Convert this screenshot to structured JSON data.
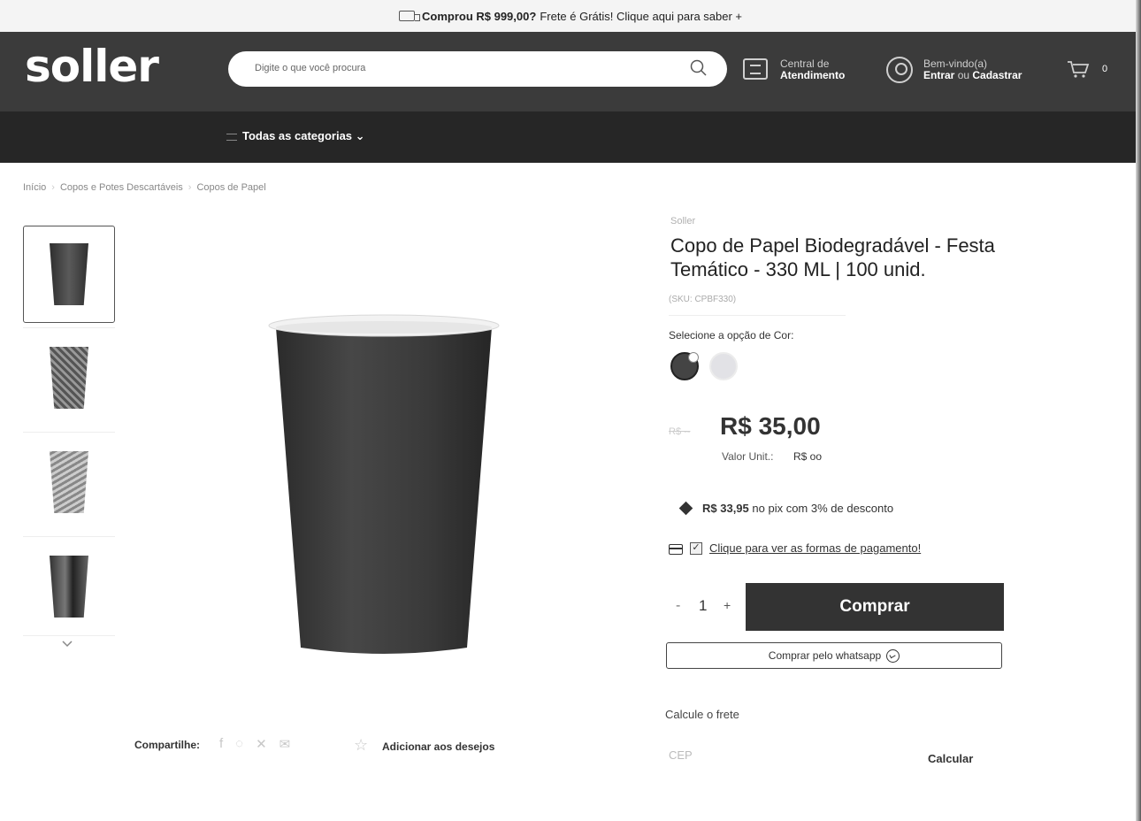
{
  "promo": {
    "bold": "Comprou R$ 999,00?",
    "text": "Frete é Grátis! Clique aqui para saber +"
  },
  "header": {
    "logo": "soller",
    "search_placeholder": "Digite o que você procura",
    "atendimento_line1": "Central de",
    "atendimento_line2": "Atendimento",
    "user_line1": "Bem-vindo(a)",
    "user_entrar": "Entrar",
    "user_ou": "ou",
    "user_cadastrar": "Cadastrar",
    "cart_count": "0"
  },
  "nav": {
    "all_categories": "Todas as categorias"
  },
  "breadcrumb": [
    "Início",
    "Copos e Potes Descartáveis",
    "Copos de Papel"
  ],
  "product": {
    "brand": "Soller",
    "title": "Copo de Papel Biodegradável - Festa Temático - 330 ML | 100 unid.",
    "sku": "(SKU: CPBF330)",
    "color_label": "Selecione a opção de Cor:",
    "price": "R$ 35,00",
    "unit_label": "Valor Unit.:",
    "unit_value": "R$ oo",
    "pix_amount": "R$ 33,95",
    "pix_text": "no pix com 3% de desconto",
    "payment_link": "Clique para ver as formas de pagamento!",
    "quantity": "1",
    "buy_label": "Comprar",
    "whatsapp_label": "Comprar pelo whatsapp",
    "frete_label": "Calcule o frete",
    "cep_placeholder": "CEP",
    "calc_label": "Calcular"
  },
  "share": {
    "label": "Compartilhe:",
    "wishlist": "Adicionar aos desejos"
  },
  "colors": {
    "header_bg": "#3b3b3b",
    "nav_bg": "#262626",
    "buy_bg": "#333333"
  }
}
